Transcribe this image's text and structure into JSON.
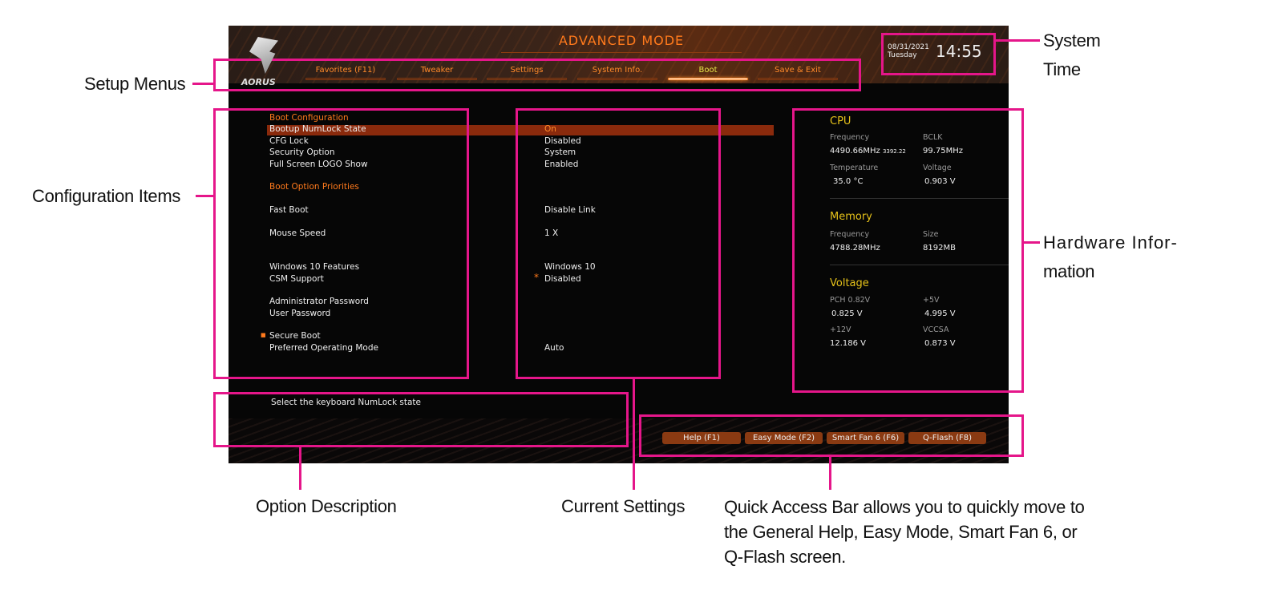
{
  "bios": {
    "mode_title": "ADVANCED MODE",
    "logo_text": "AORUS",
    "tabs": [
      "Favorites (F11)",
      "Tweaker",
      "Settings",
      "System Info.",
      "Boot",
      "Save & Exit"
    ],
    "active_tab": "Boot",
    "date": "08/31/2021",
    "day": "Tuesday",
    "time": "14:55",
    "config_items": [
      {
        "label": "Boot Configuration",
        "value": "",
        "heading": true
      },
      {
        "label": "Bootup NumLock State",
        "value": "On",
        "selected": true
      },
      {
        "label": "CFG Lock",
        "value": "Disabled"
      },
      {
        "label": "Security Option",
        "value": "System"
      },
      {
        "label": "Full Screen LOGO Show",
        "value": "Enabled"
      },
      {
        "label": "Boot Option Priorities",
        "value": "",
        "heading": true
      },
      {
        "label": "Fast Boot",
        "value": "Disable Link"
      },
      {
        "label": "Mouse Speed",
        "value": "1 X"
      },
      {
        "label": "Windows 10 Features",
        "value": "Windows 10"
      },
      {
        "label": "CSM Support",
        "value": "Disabled",
        "star": "*"
      },
      {
        "label": "Administrator Password",
        "value": ""
      },
      {
        "label": "User Password",
        "value": ""
      },
      {
        "label": "Secure Boot",
        "value": "",
        "bullet": "■"
      },
      {
        "label": "Preferred Operating Mode",
        "value": "Auto"
      }
    ],
    "description": "Select the keyboard NumLock state",
    "hardware": {
      "cpu": {
        "title": "CPU",
        "freq_label": "Frequency",
        "freq": "4490.66MHz",
        "freq_sub": "3392.22",
        "bclk_label": "BCLK",
        "bclk": "99.75MHz",
        "temp_label": "Temperature",
        "temp": "35.0 °C",
        "volt_label": "Voltage",
        "volt": "0.903 V"
      },
      "memory": {
        "title": "Memory",
        "freq_label": "Frequency",
        "freq": "4788.28MHz",
        "size_label": "Size",
        "size": "8192MB"
      },
      "voltage": {
        "title": "Voltage",
        "pch_label": "PCH 0.82V",
        "pch": "0.825 V",
        "v5_label": "+5V",
        "v5": "4.995 V",
        "v12_label": "+12V",
        "v12": "12.186 V",
        "vccsa_label": "VCCSA",
        "vccsa": "0.873 V"
      }
    },
    "quick_access": [
      "Help (F1)",
      "Easy Mode (F2)",
      "Smart Fan 6 (F6)",
      "Q-Flash (F8)"
    ]
  },
  "annotations": {
    "setup_menus": "Setup Menus",
    "system_time_1": "System",
    "system_time_2": "Time",
    "config_items": "Configuration Items",
    "hardware_1": "Hardware Infor-",
    "hardware_2": "mation",
    "option_description": "Option Description",
    "current_settings": "Current Settings",
    "quick_access_1": "Quick Access Bar allows you to quickly move to",
    "quick_access_2": "the General Help, Easy Mode, Smart Fan 6, or",
    "quick_access_3": "Q-Flash screen."
  },
  "colors": {
    "annotation": "#e5168a",
    "accent": "#ff7a1c",
    "highlight": "#8a2a0c"
  }
}
